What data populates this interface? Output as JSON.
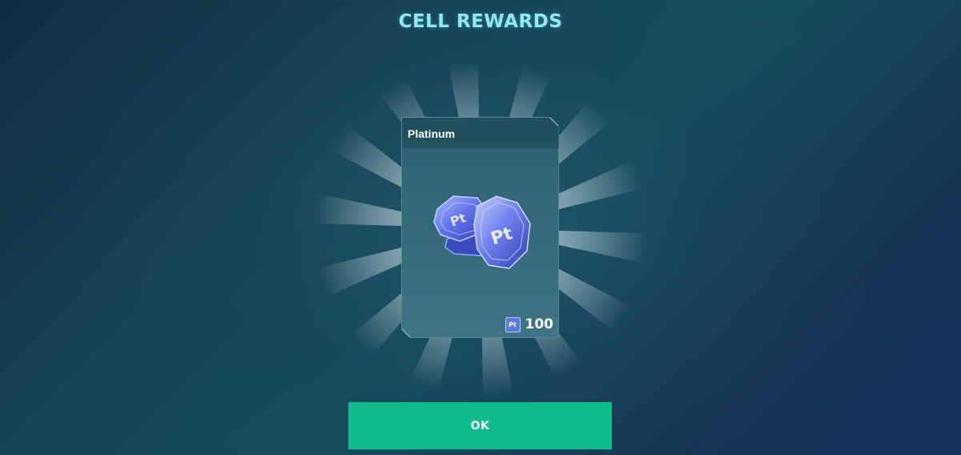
{
  "header": {
    "title": "CELL REWARDS"
  },
  "reward_card": {
    "name": "Platinum",
    "currency_badge": "Pt",
    "amount": "100",
    "item_icon": "platinum-coins-icon"
  },
  "actions": {
    "ok_label": "OK"
  },
  "colors": {
    "title": "#8fe9f5",
    "ok_button": "#0fbd8a",
    "card": "#356a7b",
    "background": "#154d5e"
  }
}
